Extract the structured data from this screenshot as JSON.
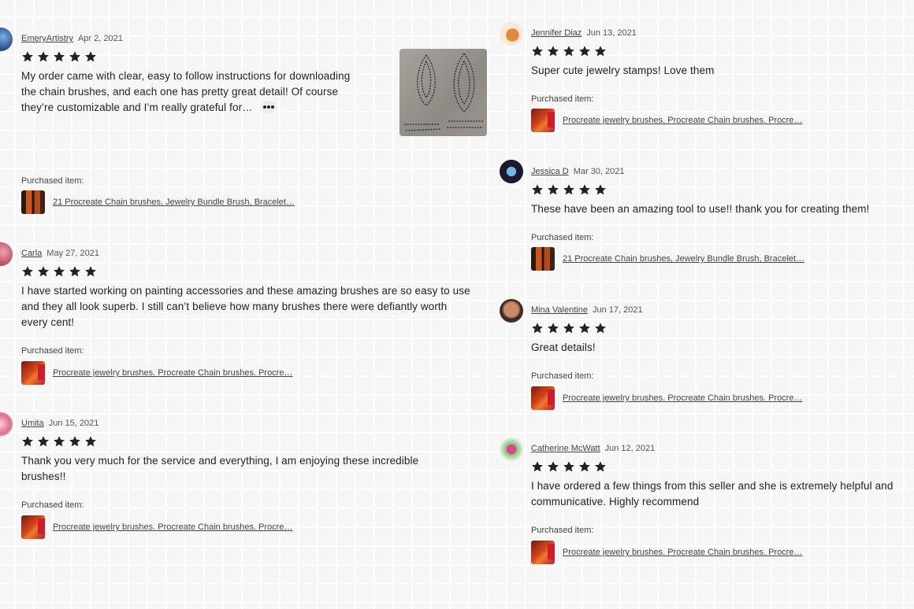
{
  "icons": {
    "star": "star-icon",
    "more": "more-dots-icon"
  },
  "colors": {
    "star": "#222222",
    "link": "#444444"
  },
  "purchased_label": "Purchased item:",
  "reviews": [
    {
      "reviewer": "EmeryArtistry",
      "date": "Apr 2, 2021",
      "rating": 5,
      "text": "My order came with clear, easy to follow instructions for downloading the chain brushes, and each one has pretty great detail! Of course they’re customizable and I’m really grateful for…",
      "product": "21 Procreate Chain brushes, Jewelry Bundle Brush, Bracelet…"
    },
    {
      "reviewer": "Carla",
      "date": "May 27, 2021",
      "rating": 5,
      "text": "I have started working on painting accessories and these amazing brushes are so easy to use and they all look superb. I still can’t believe how many brushes there were defiantly worth every cent!",
      "product": "Procreate jewelry brushes. Procreate Chain brushes. Procre…"
    },
    {
      "reviewer": "Umita",
      "date": "Jun 15, 2021",
      "rating": 5,
      "text": "Thank you very much for the service and everything, I am enjoying these incredible brushes!!",
      "product": "Procreate jewelry brushes. Procreate Chain brushes. Procre…"
    },
    {
      "reviewer": "Jennifer Diaz",
      "date": "Jun 13, 2021",
      "rating": 5,
      "text": "Super cute jewelry stamps! Love them",
      "product": "Procreate jewelry brushes. Procreate Chain brushes. Procre…"
    },
    {
      "reviewer": "Jessica D",
      "date": "Mar 30, 2021",
      "rating": 5,
      "text": "These have been an amazing tool to use!! thank you for creating them!",
      "product": "21 Procreate Chain brushes, Jewelry Bundle Brush, Bracelet…"
    },
    {
      "reviewer": "Mina Valentine",
      "date": "Jun 17, 2021",
      "rating": 5,
      "text": "Great details!",
      "product": "Procreate jewelry brushes. Procreate Chain brushes. Procre…"
    },
    {
      "reviewer": "Catherine McWatt",
      "date": "Jun 12, 2021",
      "rating": 5,
      "text": "I have ordered a few things from this seller and she is extremely helpful and communicative. Highly recommend",
      "product": "Procreate jewelry brushes. Procreate Chain brushes. Procre…"
    }
  ]
}
